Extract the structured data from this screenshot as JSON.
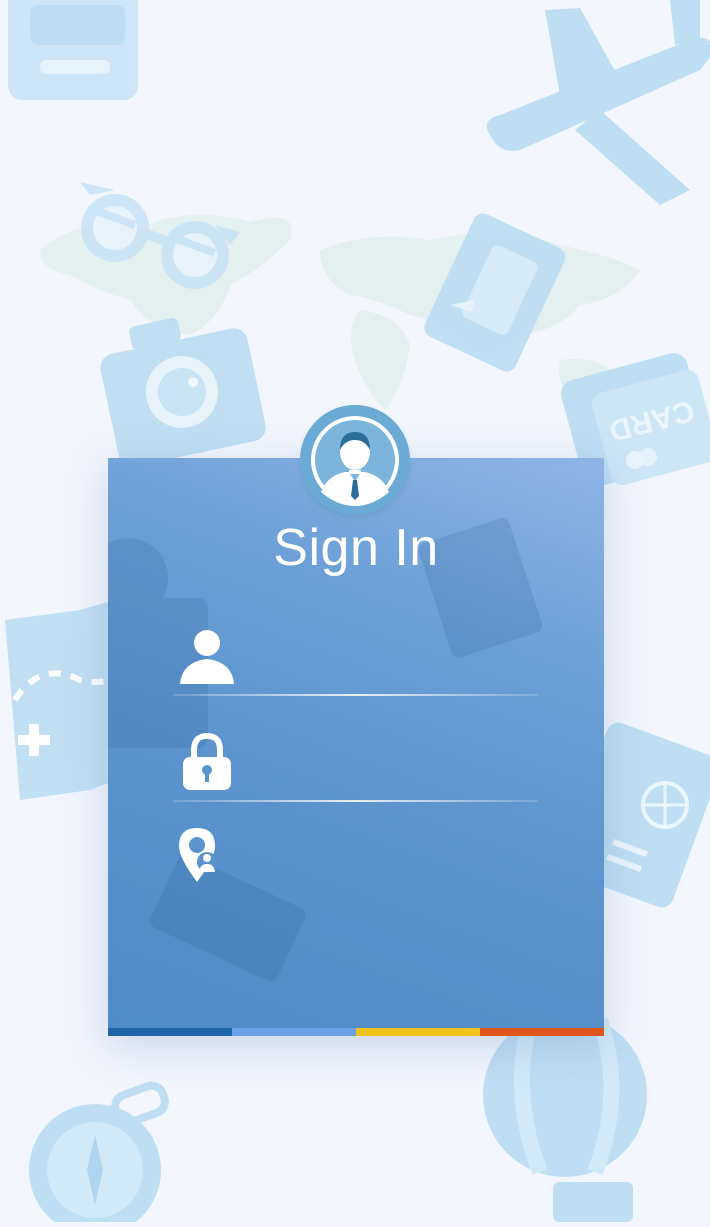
{
  "title": "Sign In",
  "fields": {
    "username": {
      "icon": "user-icon",
      "value": "",
      "placeholder": ""
    },
    "password": {
      "icon": "lock-icon",
      "value": "",
      "placeholder": ""
    },
    "location": {
      "icon": "location-pin-icon",
      "value": "",
      "placeholder": ""
    }
  },
  "card_label": "CARD",
  "colors": {
    "background": "#f3f6fd",
    "card": "#5b93cc",
    "avatar": "#6aaad4",
    "accent_bar": [
      "#1f63a8",
      "#6aa0e6",
      "#f2c31a",
      "#e0571e"
    ]
  }
}
